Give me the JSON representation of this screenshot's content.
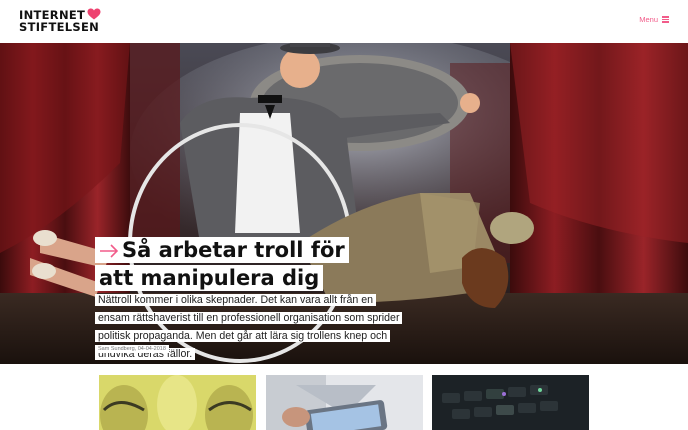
{
  "header": {
    "logo_line1": "INTERNET",
    "logo_line2": "STIFTELSEN",
    "menu_label": "Menu",
    "accent_color": "#f25c8a",
    "logo_icon": "heart-icon",
    "menu_icon": "hamburger-icon"
  },
  "hero": {
    "title": "Så arbetar troll för att manipulera dig",
    "lead": "Nättroll kommer i olika skepnader. Det kan vara allt från en ensam rättshaverist till en professionell organisation som sprider politisk propaganda. Men det går att lära sig trollens knep och undvika deras fällor.",
    "byline": "Sam Sundberg, 04-04-2018",
    "title_icon": "arrow-right-icon"
  },
  "cards": [
    {
      "image": "card-image-yellow-faces"
    },
    {
      "image": "card-image-tablet-hands"
    },
    {
      "image": "card-image-dark-keyboard"
    }
  ]
}
